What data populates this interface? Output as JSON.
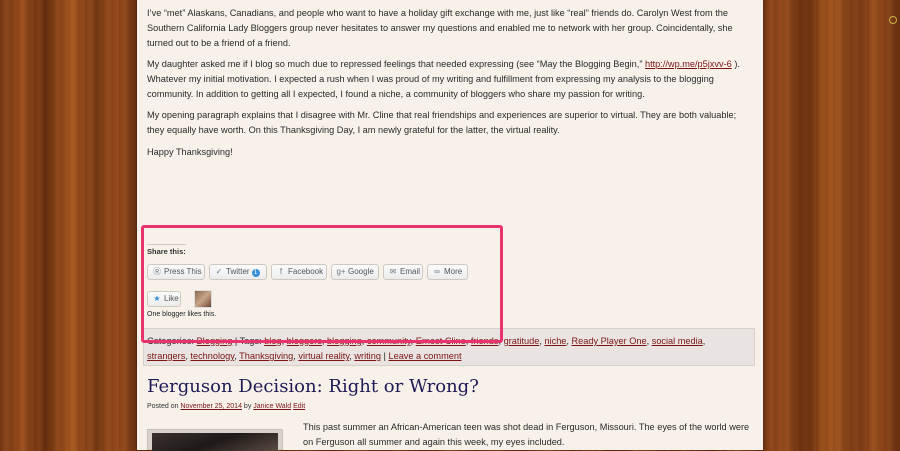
{
  "paragraphs": {
    "p1": "I’ve “met” Alaskans, Canadians, and people who want to have a holiday gift exchange with me, just like “real” friends do.  Carolyn West from the Southern California Lady Bloggers group never hesitates to answer my questions and enabled me to network with her group.  Coincidentally, she turned out to be a friend of a friend.",
    "p2_before": "My daughter asked me if I blog so much due to repressed feelings that needed expressing (see “May the Blogging Begin,”",
    "p2_link": "http://wp.me/p5jxvv-6",
    "p2_after": ").  Whatever my initial motivation.  I expected a rush when I was proud of my writing and fulfillment from expressing my analysis to the blogging community.  In addition to getting all I expected, I found a niche, a community of bloggers who share my passion for writing.",
    "p3": "My opening paragraph explains that I disagree with Mr. Cline that real friendships and experiences are superior to virtual.  They are both valuable; they equally have worth.  On this Thanksgiving Day, I am newly grateful for the latter, the virtual reality.",
    "p4": "Happy Thanksgiving!"
  },
  "share": {
    "title": "Share this:",
    "buttons": [
      {
        "label": "Press This",
        "icon": "wordpress-icon"
      },
      {
        "label": "Twitter",
        "icon": "twitter-icon",
        "count": "1"
      },
      {
        "label": "Facebook",
        "icon": "facebook-icon"
      },
      {
        "label": "Google",
        "icon": "googleplus-icon"
      },
      {
        "label": "Email",
        "icon": "email-icon"
      },
      {
        "label": "More",
        "icon": "more-icon"
      }
    ],
    "like_label": "Like",
    "likes_text": "One blogger likes this."
  },
  "categories": {
    "cat_label": "Categories:",
    "cat_link": "Blogging",
    "sep": "|",
    "tags_label": "Tags:",
    "tags": [
      "blog",
      "bloggers",
      "blogging",
      "community",
      "Ernest Cline",
      "friends",
      "gratitude",
      "niche",
      "Ready Player One",
      "social media",
      "strangers",
      "technology",
      "Thanksgiving",
      "virtual reality",
      "writing"
    ],
    "leave_comment": "Leave a comment"
  },
  "next_post": {
    "title": "Ferguson Decision: Right or Wrong?",
    "posted_on": "Posted on",
    "date": "November 25, 2014",
    "by": "by",
    "author": "Janice Wald",
    "edit": "Edit",
    "excerpt": "This past summer an African-American teen was shot dead in Ferguson, Missouri.  The eyes of the world were on Ferguson all summer and again this week, my eyes included."
  },
  "colors": {
    "link": "#7a1414",
    "title": "#1f1a55",
    "highlight": "#e8336f",
    "page_bg": "#f7f1ea"
  }
}
